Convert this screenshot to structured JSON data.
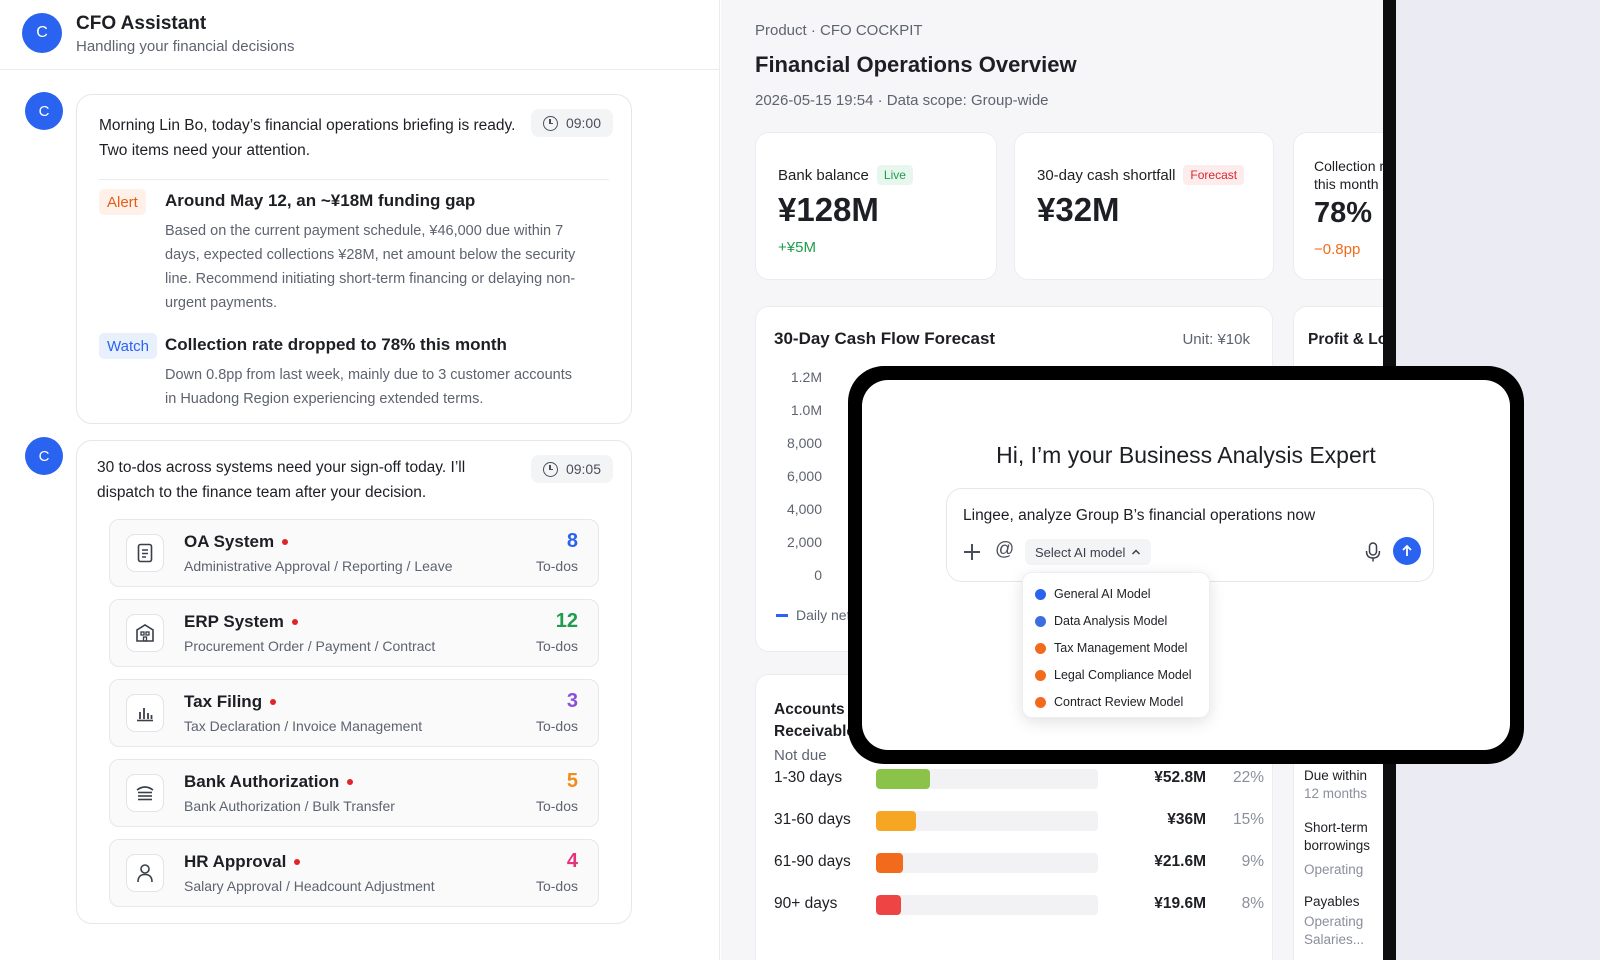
{
  "chat": {
    "header": {
      "avatar": "C",
      "title": "CFO Assistant",
      "subtitle": "Handling your financial decisions"
    },
    "message1": {
      "avatar": "C",
      "time": "09:00",
      "intro_line1": "Morning Lin Bo, today’s financial operations briefing is ready.",
      "intro_line2": "Two items need your attention.",
      "items": [
        {
          "tag": "Alert",
          "title": "Around May 12, an ~¥18M funding gap",
          "body": "Based on the current payment schedule, ¥46,000 due within 7 days, expected collections ¥28M, net amount below the security line. Recommend initiating short-term financing or delaying non-urgent payments."
        },
        {
          "tag": "Watch",
          "title": "Collection rate dropped to 78% this month",
          "body": "Down 0.8pp from last week, mainly due to 3 customer accounts in Huadong Region experiencing extended terms."
        }
      ]
    },
    "message2": {
      "avatar": "C",
      "time": "09:05",
      "intro_line1": "30 to-dos across systems need your sign-off today. I’ll",
      "intro_line2": "dispatch to the finance team after your decision.",
      "todos": [
        {
          "name": "OA System",
          "desc": "Administrative Approval / Reporting / Leave",
          "count": "8",
          "unit": "To-dos",
          "color": "#2a63f0",
          "icon": "document-icon"
        },
        {
          "name": "ERP System",
          "desc": "Procurement Order / Payment / Contract",
          "count": "12",
          "unit": "To-dos",
          "color": "#1f9d4d",
          "icon": "building-icon"
        },
        {
          "name": "Tax Filing",
          "desc": "Tax Declaration / Invoice Management",
          "count": "3",
          "unit": "To-dos",
          "color": "#8b4fd8",
          "icon": "bar-chart-icon"
        },
        {
          "name": "Bank Authorization",
          "desc": "Bank Authorization / Bulk Transfer",
          "count": "5",
          "unit": "To-dos",
          "color": "#f28c1a",
          "icon": "bank-icon"
        },
        {
          "name": "HR Approval",
          "desc": "Salary Approval / Headcount Adjustment",
          "count": "4",
          "unit": "To-dos",
          "color": "#e2337d",
          "icon": "person-icon"
        }
      ]
    }
  },
  "dashboard": {
    "breadcrumb": "Product · CFO COCKPIT",
    "title": "Financial Operations Overview",
    "meta": "2026-05-15 19:54 · Data scope: Group-wide",
    "kpis": [
      {
        "label": "Bank balance",
        "chip": "Live",
        "value": "¥128M",
        "delta": "+¥5M",
        "delta_color": "#1f9d4d"
      },
      {
        "label": "30-day cash shortfall",
        "chip": "Forecast",
        "value": "¥32M",
        "delta": ""
      },
      {
        "label_line1": "Collection ra",
        "label_line2": "this month",
        "value": "78%",
        "delta": "−0.8pp",
        "delta_color": "#f26b1d"
      }
    ],
    "cashflow": {
      "title": "30-Day Cash Flow Forecast",
      "unit": "Unit: ¥10k",
      "yticks": [
        "1.2M",
        "1.0M",
        "8,000",
        "6,000",
        "4,000",
        "2,000",
        "0"
      ],
      "legend": "Daily net"
    },
    "profit_card_title": "Profit & Loss",
    "ar": {
      "title_line1": "Accounts",
      "title_line2": "Receivable",
      "not_due": "Not due",
      "rows": [
        {
          "label": "1-30 days",
          "value": "¥52.8M",
          "pct": "22%",
          "fill": 0.22,
          "color": "#8bc34a"
        },
        {
          "label": "31-60 days",
          "value": "¥36M",
          "pct": "15%",
          "fill": 0.15,
          "color": "#f5a623"
        },
        {
          "label": "61-90 days",
          "value": "¥21.6M",
          "pct": "9%",
          "fill": 0.09,
          "color": "#f26b1d"
        },
        {
          "label": "90+ days",
          "value": "¥19.6M",
          "pct": "8%",
          "fill": 0.08,
          "color": "#ef4444"
        }
      ]
    },
    "side": {
      "due1": "Due within",
      "due2": "12 months",
      "st1": "Short-term",
      "st2": "borrowings",
      "op1": "Operating",
      "payables": "Payables",
      "op2": "Operating",
      "salaries": "Salaries..."
    }
  },
  "overlay": {
    "title": "Hi, I’m your Business Analysis Expert",
    "prompt": "Lingee, analyze Group B’s financial operations now",
    "select_label": "Select AI model",
    "models": [
      {
        "label": "General AI Model",
        "color": "#2a63f0"
      },
      {
        "label": "Data Analysis Model",
        "color": "#3b6fe0"
      },
      {
        "label": "Tax Management Model",
        "color": "#f26b1d"
      },
      {
        "label": "Legal Compliance Model",
        "color": "#f26b1d"
      },
      {
        "label": "Contract Review Model",
        "color": "#f26b1d"
      }
    ]
  }
}
